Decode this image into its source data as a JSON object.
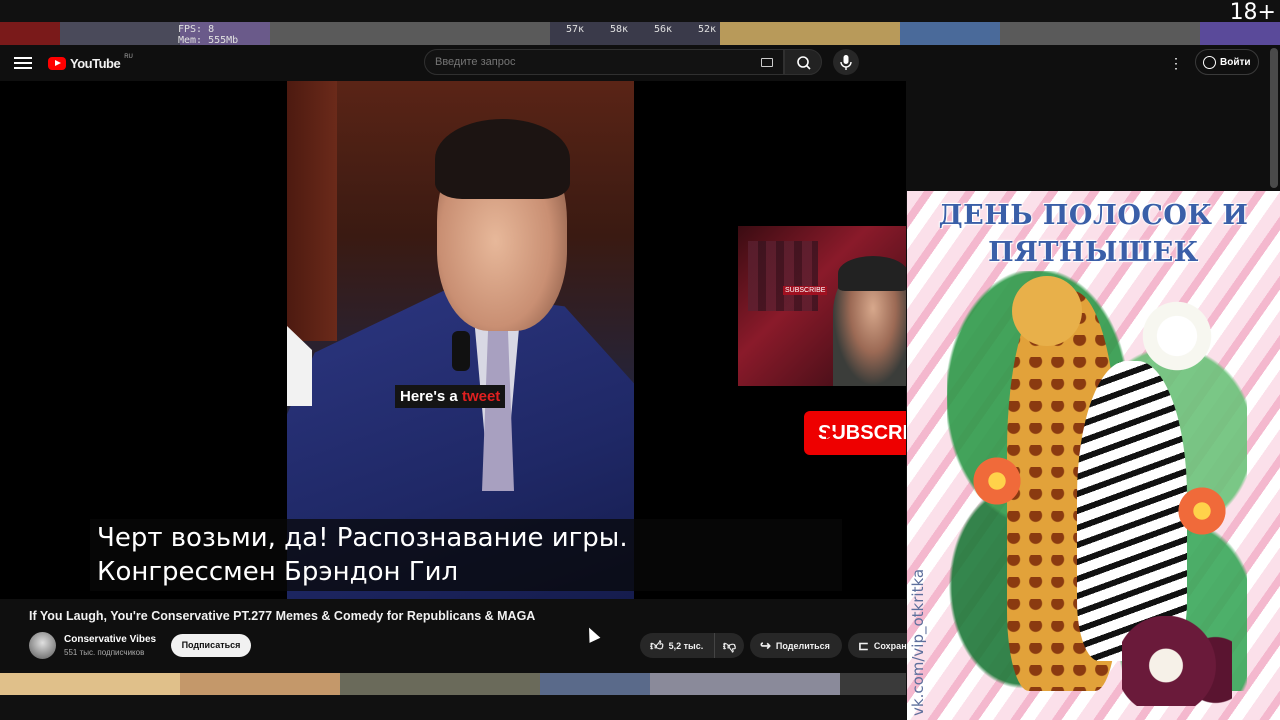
{
  "overlay": {
    "fps": "FPS: 8",
    "mem": "Mem: 555Mb",
    "age_rating": "18+",
    "stats": [
      "57к",
      "58к",
      "56к",
      "52к"
    ]
  },
  "header": {
    "logo_text": "YouTube",
    "logo_region": "RU",
    "search_placeholder": "Введите запрос",
    "signin_label": "Войти"
  },
  "video": {
    "burned_caption_main": "Here's a ",
    "burned_caption_accent": "tweet",
    "subtitle_line1": "Черт возьми, да!  Распознавание игры.",
    "subtitle_line2": "Конгрессмен Брэндон Гил",
    "cam_label": "SUBSCRIBE",
    "subscribe_overlay": "SUBSCRIBE"
  },
  "meta": {
    "title": "If You Laugh, You're Conservative PT.277 Memes & Comedy for Republicans & MAGA",
    "channel": "Conservative Vibes",
    "subscribers": "551 тыс. подписчиков",
    "subscribe_label": "Подписаться",
    "likes": "5,2 тыс.",
    "share_label": "Поделиться",
    "save_label": "Сохран"
  },
  "card": {
    "title_line1": "ДЕНЬ ПОЛОСОК И",
    "title_line2": "ПЯТНЫШЕК",
    "url": "vk.com/vip_otkritka"
  },
  "colors": {
    "accent": "#ff0000",
    "background": "#0f0f0f"
  }
}
